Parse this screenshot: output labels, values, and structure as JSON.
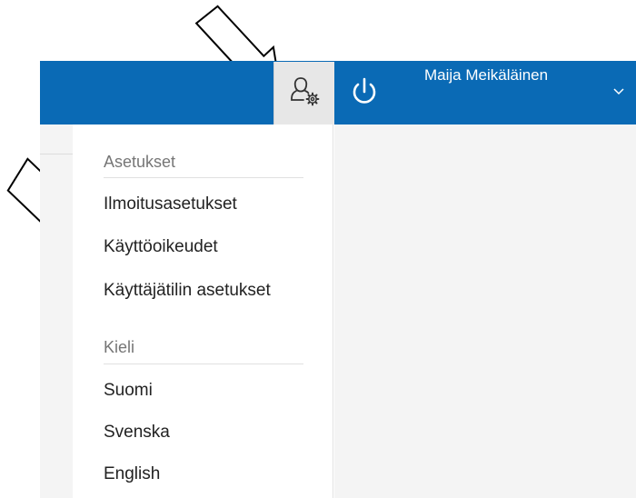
{
  "header": {
    "user_name": "Maija Meikäläinen",
    "accent_color": "#0a6ab5",
    "settings_icon": "user-settings-icon",
    "power_icon": "power-icon",
    "chevron_icon": "chevron-down-icon"
  },
  "menu": {
    "settings_header": "Asetukset",
    "settings_items": [
      "Ilmoitusasetukset",
      "Käyttöoikeudet",
      "Käyttäjätilin asetukset"
    ],
    "language_header": "Kieli",
    "language_items": [
      "Suomi",
      "Svenska",
      "English"
    ]
  }
}
